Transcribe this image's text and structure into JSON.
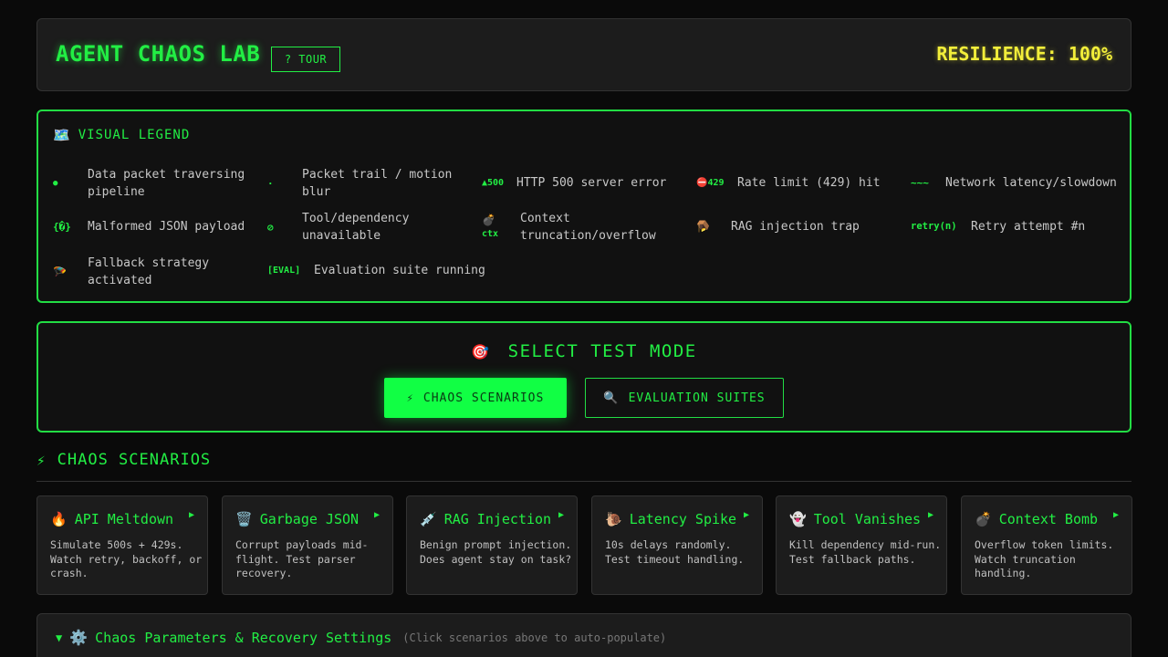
{
  "header": {
    "title": "AGENT CHAOS LAB",
    "tour_label": "? TOUR",
    "resilience": "RESILIENCE: 100%"
  },
  "legend": {
    "title": "VISUAL LEGEND",
    "title_icon": "map-icon",
    "items": [
      {
        "symbol": "●",
        "text": "Data packet traversing pipeline"
      },
      {
        "symbol": "·",
        "text": "Packet trail / motion blur"
      },
      {
        "symbol": "▲500",
        "text": "HTTP 500 server error"
      },
      {
        "symbol": "⛔429",
        "text": "Rate limit (429) hit"
      },
      {
        "symbol": "~~~",
        "text": "Network latency/slowdown"
      },
      {
        "symbol": "{�}",
        "text": "Malformed JSON payload"
      },
      {
        "symbol": "⊘",
        "text": "Tool/dependency unavailable"
      },
      {
        "symbol": "💣",
        "symbol2": "ctx",
        "text": "Context truncation/overflow"
      },
      {
        "symbol": "🪤",
        "text": "RAG injection trap"
      },
      {
        "symbol": "retry(n)",
        "text": "Retry attempt #n"
      },
      {
        "symbol": "🪂",
        "text": "Fallback strategy activated"
      },
      {
        "symbol": "[EVAL]",
        "text": "Evaluation suite running"
      }
    ]
  },
  "mode": {
    "title": "SELECT TEST MODE",
    "title_icon": "target-icon",
    "chaos_label": "CHAOS SCENARIOS",
    "eval_label": "EVALUATION SUITES"
  },
  "scenarios": {
    "title": "CHAOS SCENARIOS",
    "cards": [
      {
        "icon": "🔥",
        "name": "API Meltdown",
        "desc": "Simulate 500s + 429s. Watch retry, backoff, or crash."
      },
      {
        "icon": "🗑️",
        "name": "Garbage JSON",
        "desc": "Corrupt payloads mid-flight. Test parser recovery."
      },
      {
        "icon": "💉",
        "name": "RAG Injection",
        "desc": "Benign prompt injection. Does agent stay on task?"
      },
      {
        "icon": "🐌",
        "name": "Latency Spike",
        "desc": "10s delays randomly. Test timeout handling."
      },
      {
        "icon": "👻",
        "name": "Tool Vanishes",
        "desc": "Kill dependency mid-run. Test fallback paths."
      },
      {
        "icon": "💣",
        "name": "Context Bomb",
        "desc": "Overflow token limits. Watch truncation handling."
      }
    ]
  },
  "params": {
    "title": "Chaos Parameters & Recovery Settings",
    "hint": "(Click scenarios above to auto-populate)"
  },
  "colors": {
    "accent": "#22ee44",
    "warning": "#f2ee3a",
    "background": "#0a0a0a"
  }
}
